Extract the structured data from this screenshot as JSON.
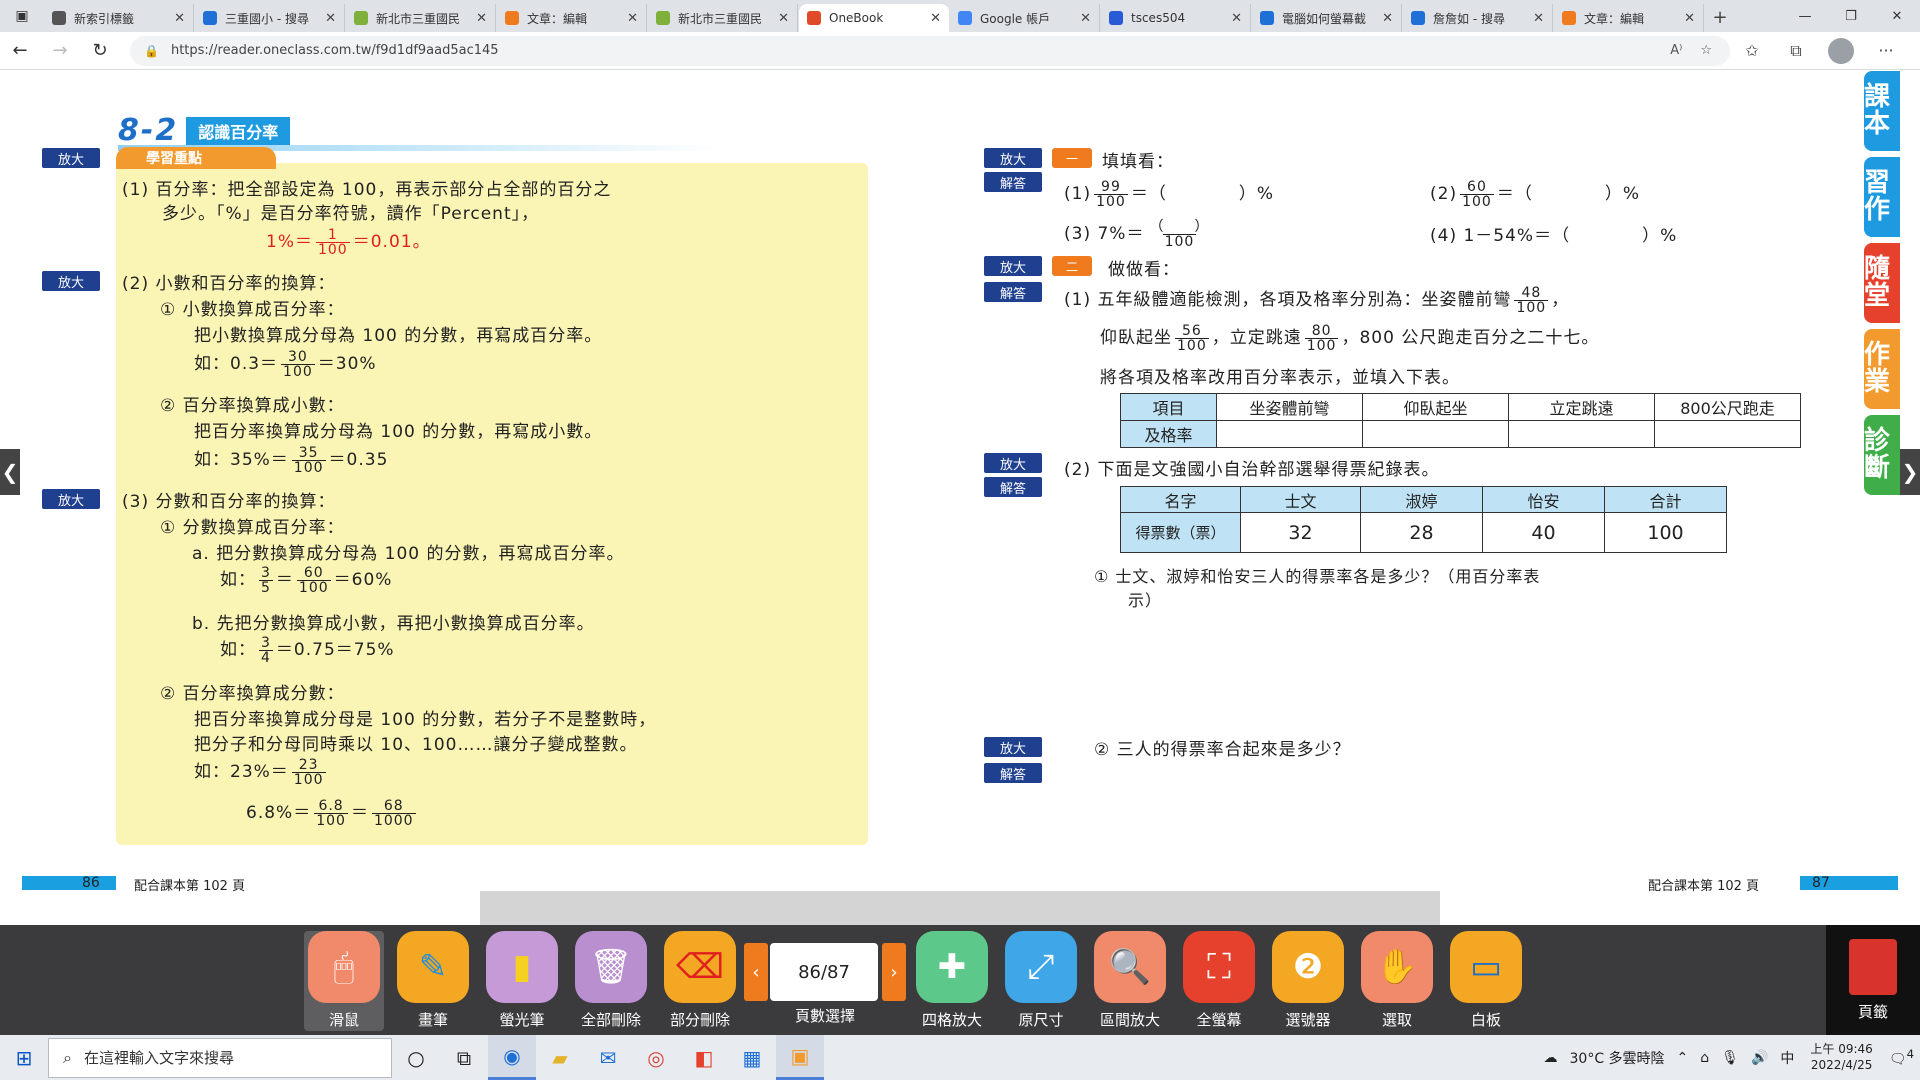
{
  "browser": {
    "tabs": [
      {
        "title": "新索引標籤",
        "color": "#555"
      },
      {
        "title": "三重國小 - 搜尋",
        "color": "#1e6fd6"
      },
      {
        "title": "新北市三重國民",
        "color": "#7fb03c"
      },
      {
        "title": "文章：編輯",
        "color": "#f07b1f"
      },
      {
        "title": "新北市三重國民",
        "color": "#7fb03c"
      },
      {
        "title": "OneBook",
        "color": "#e04a2a",
        "active": true
      },
      {
        "title": "Google 帳戶",
        "color": "#4285f4"
      },
      {
        "title": "tsces504",
        "color": "#2a5bd7"
      },
      {
        "title": "電腦如何螢幕截",
        "color": "#1e6fd6"
      },
      {
        "title": "詹詹如 - 搜尋",
        "color": "#1e6fd6"
      },
      {
        "title": "文章：編輯",
        "color": "#f07b1f"
      }
    ],
    "url": "https://reader.oneclass.com.tw/f9d1df9aad5ac145"
  },
  "left_page": {
    "lesson_number": "8-2",
    "lesson_title": "認識百分率",
    "zoom": "放大",
    "keypoints_tag": "學習重點",
    "lines": {
      "l1": "(1) 百分率：把全部設定為 100，再表示部分占全部的百分之",
      "l2": "多少。「%」是百分率符號，讀作「Percent」，",
      "l3a": "1%＝",
      "l3b": "1",
      "l3c": "100",
      "l3d": "＝0.01。",
      "l4": "(2) 小數和百分率的換算：",
      "l5": "① 小數換算成百分率：",
      "l6": "把小數換算成分母為 100 的分數，再寫成百分率。",
      "l7a": "如：0.3＝",
      "l7n": "30",
      "l7d": "100",
      "l7b": "＝30%",
      "l8": "② 百分率換算成小數：",
      "l9": "把百分率換算成分母為 100 的分數，再寫成小數。",
      "l10a": "如：35%＝",
      "l10n": "35",
      "l10d": "100",
      "l10b": "＝0.35",
      "l11": "(3) 分數和百分率的換算：",
      "l12": "① 分數換算成百分率：",
      "l13": "a. 把分數換算成分母為 100 的分數，再寫成百分率。",
      "l14a": "如：",
      "l14n1": "3",
      "l14d1": "5",
      "l14m": "＝",
      "l14n2": "60",
      "l14d2": "100",
      "l14b": "＝60%",
      "l15": "b. 先把分數換算成小數，再把小數換算成百分率。",
      "l16a": "如：",
      "l16n": "3",
      "l16d": "4",
      "l16b": "＝0.75＝75%",
      "l17": "② 百分率換算成分數：",
      "l18": "把百分率換算成分母是 100 的分數，若分子不是整數時，",
      "l19": "把分子和分母同時乘以 10、100……讓分子變成整數。",
      "l20a": "如：23%＝",
      "l20n": "23",
      "l20d": "100",
      "l21a": "6.8%＝",
      "l21n1": "6.8",
      "l21d1": "100",
      "l21m": "＝",
      "l21n2": "68",
      "l21d2": "1000"
    },
    "page_number": "86",
    "course_ref": "配合課本第 102 頁"
  },
  "right_page": {
    "zoom": "放大",
    "answer": "解答",
    "sec1_tag": "一",
    "sec1_title": "填填看：",
    "q1_label": "(1)",
    "q1_n": "99",
    "q1_d": "100",
    "q1_rest": "＝（　　　　）%",
    "q2_label": "(2)",
    "q2_n": "60",
    "q2_d": "100",
    "q2_rest": "＝（　　　　）%",
    "q3_label": "(3) 7%＝",
    "q3_n": "（　　）",
    "q3_d": "100",
    "q4": "(4) 1－54%＝（　　　　）%",
    "sec2_tag": "二",
    "sec2_title": "做做看：",
    "p1_a": "(1) 五年級體適能檢測，各項及格率分別為：坐姿體前彎",
    "p1_n": "48",
    "p1_d": "100",
    "p1_b": "，",
    "p2_a": "仰臥起坐",
    "p2_n1": "56",
    "p2_d1": "100",
    "p2_b": "，立定跳遠",
    "p2_n2": "80",
    "p2_d2": "100",
    "p2_c": "，800 公尺跑走百分之二十七。",
    "p3": "將各項及格率改用百分率表示，並填入下表。",
    "table1": {
      "headers": [
        "項目",
        "坐姿體前彎",
        "仰臥起坐",
        "立定跳遠",
        "800公尺跑走"
      ],
      "row_label": "及格率"
    },
    "p4": "(2) 下面是文強國小自治幹部選舉得票紀錄表。",
    "table2": {
      "headers": [
        "名字",
        "士文",
        "淑婷",
        "怡安",
        "合計"
      ],
      "row_label": "得票數（票）",
      "values": [
        "32",
        "28",
        "40",
        "100"
      ]
    },
    "p5a": "① 士文、淑婷和怡安三人的得票率各是多少？（用百分率表",
    "p5b": "示）",
    "p6": "② 三人的得票率合起來是多少？",
    "page_number": "87",
    "course_ref": "配合課本第 102 頁"
  },
  "side_tabs": [
    {
      "label": "課本",
      "color": "#1e9be0"
    },
    {
      "label": "習作",
      "color": "#1e9be0"
    },
    {
      "label": "隨堂",
      "color": "#e5412c"
    },
    {
      "label": "作業",
      "color": "#f39a2f"
    },
    {
      "label": "診斷",
      "color": "#3fae49"
    }
  ],
  "toolbar": {
    "mouse": "滑鼠",
    "pen": "畫筆",
    "highlighter": "螢光筆",
    "clear_all": "全部刪除",
    "partial_delete": "部分刪除",
    "page_value": "86/87",
    "page_select": "頁數選擇",
    "four_grid": "四格放大",
    "original": "原尺寸",
    "area_zoom": "區間放大",
    "fullscreen": "全螢幕",
    "picker": "選號器",
    "select": "選取",
    "whiteboard": "白板",
    "toc": "頁籤"
  },
  "taskbar": {
    "search_placeholder": "在這裡輸入文字來搜尋",
    "weather": "30°C 多雲時陰",
    "ime": "中",
    "time": "上午 09:46",
    "date": "2022/4/25",
    "notifications": "4"
  }
}
